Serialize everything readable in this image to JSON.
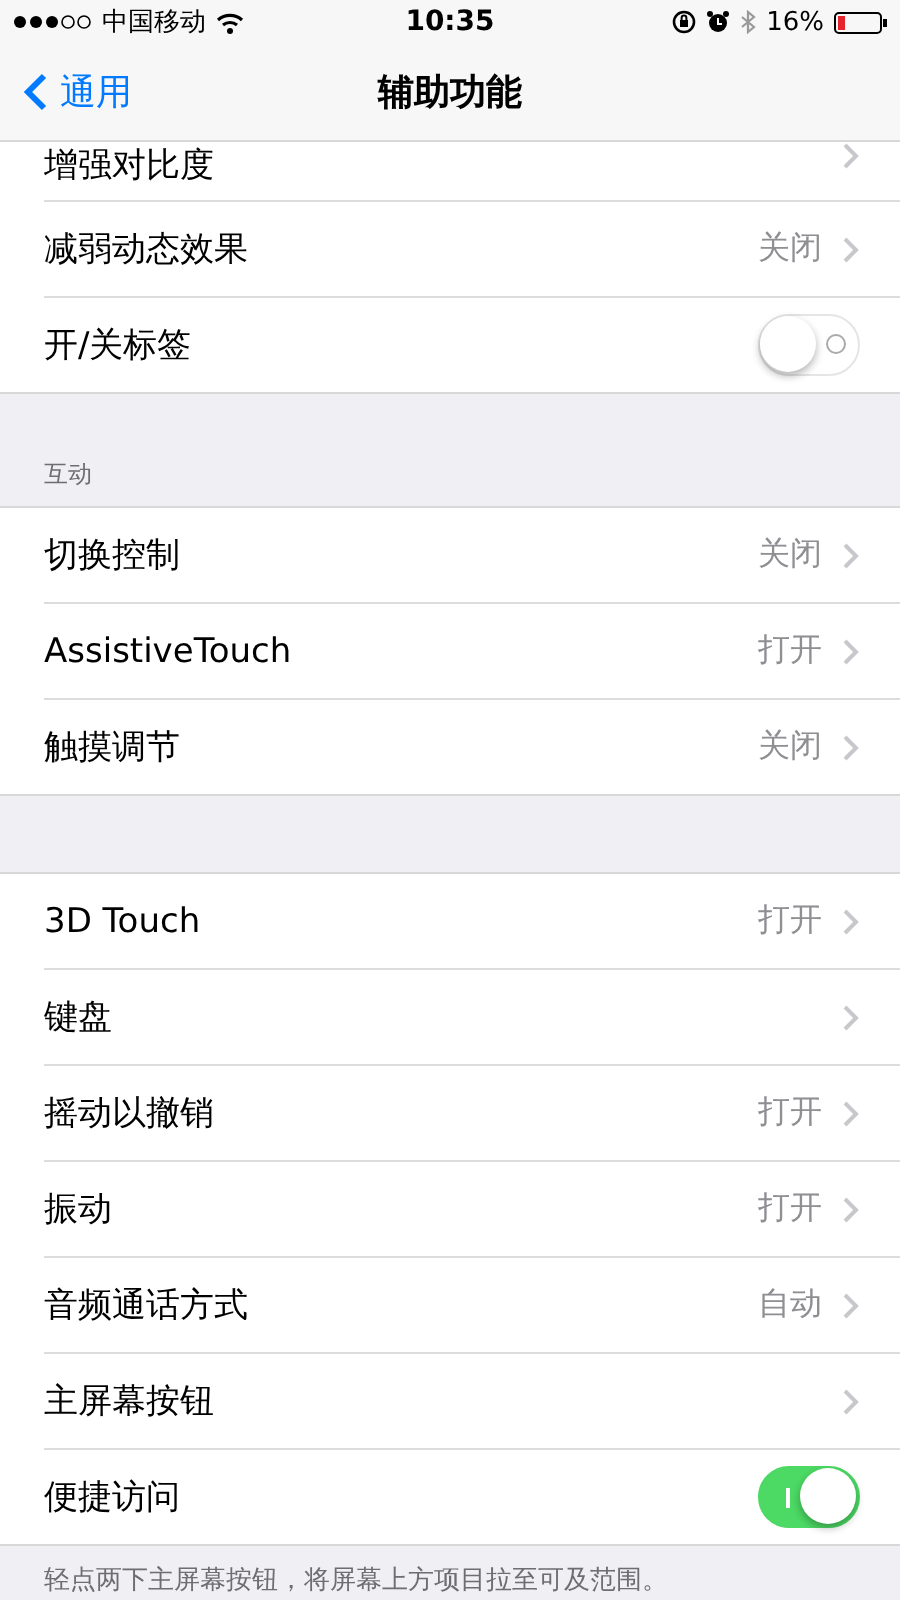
{
  "status_bar": {
    "carrier": "中国移动",
    "time": "10:35",
    "battery": "16%"
  },
  "nav": {
    "back": "通用",
    "title": "辅助功能"
  },
  "groups": [
    {
      "items": [
        {
          "kind": "link",
          "label": "增强对比度"
        },
        {
          "kind": "link",
          "label": "减弱动态效果",
          "value": "关闭"
        },
        {
          "kind": "toggle",
          "label": "开/关标签",
          "on": false
        }
      ]
    },
    {
      "header": "互动",
      "items": [
        {
          "kind": "link",
          "label": "切换控制",
          "value": "关闭"
        },
        {
          "kind": "link",
          "label": "AssistiveTouch",
          "value": "打开"
        },
        {
          "kind": "link",
          "label": "触摸调节",
          "value": "关闭"
        }
      ]
    },
    {
      "items": [
        {
          "kind": "link",
          "label": "3D Touch",
          "value": "打开"
        },
        {
          "kind": "link",
          "label": "键盘"
        },
        {
          "kind": "link",
          "label": "摇动以撤销",
          "value": "打开"
        },
        {
          "kind": "link",
          "label": "振动",
          "value": "打开"
        },
        {
          "kind": "link",
          "label": "音频通话方式",
          "value": "自动"
        },
        {
          "kind": "link",
          "label": "主屏幕按钮"
        },
        {
          "kind": "toggle",
          "label": "便捷访问",
          "on": true
        }
      ],
      "footer": "轻点两下主屏幕按钮，将屏幕上方项目拉至可及范围。"
    }
  ]
}
